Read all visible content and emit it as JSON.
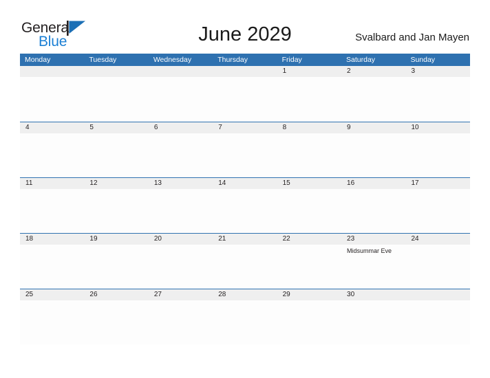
{
  "brand": {
    "name_part1": "General",
    "name_part2": "Blue",
    "flag_icon": "flag-triangle-icon",
    "accent_color": "#1b7fd4"
  },
  "header": {
    "month_title": "June 2029",
    "region": "Svalbard and Jan Mayen"
  },
  "colors": {
    "header_blue": "#2e71b0",
    "band_gray": "#efefef",
    "text_dark": "#231f20",
    "logo_blue": "#1b7fd4"
  },
  "weekdays": [
    {
      "label": "Monday"
    },
    {
      "label": "Tuesday"
    },
    {
      "label": "Wednesday"
    },
    {
      "label": "Thursday"
    },
    {
      "label": "Friday"
    },
    {
      "label": "Saturday"
    },
    {
      "label": "Sunday"
    }
  ],
  "weeks": [
    {
      "days": [
        {
          "date": "",
          "event": ""
        },
        {
          "date": "",
          "event": ""
        },
        {
          "date": "",
          "event": ""
        },
        {
          "date": "",
          "event": ""
        },
        {
          "date": "1",
          "event": ""
        },
        {
          "date": "2",
          "event": ""
        },
        {
          "date": "3",
          "event": ""
        }
      ]
    },
    {
      "days": [
        {
          "date": "4",
          "event": ""
        },
        {
          "date": "5",
          "event": ""
        },
        {
          "date": "6",
          "event": ""
        },
        {
          "date": "7",
          "event": ""
        },
        {
          "date": "8",
          "event": ""
        },
        {
          "date": "9",
          "event": ""
        },
        {
          "date": "10",
          "event": ""
        }
      ]
    },
    {
      "days": [
        {
          "date": "11",
          "event": ""
        },
        {
          "date": "12",
          "event": ""
        },
        {
          "date": "13",
          "event": ""
        },
        {
          "date": "14",
          "event": ""
        },
        {
          "date": "15",
          "event": ""
        },
        {
          "date": "16",
          "event": ""
        },
        {
          "date": "17",
          "event": ""
        }
      ]
    },
    {
      "days": [
        {
          "date": "18",
          "event": ""
        },
        {
          "date": "19",
          "event": ""
        },
        {
          "date": "20",
          "event": ""
        },
        {
          "date": "21",
          "event": ""
        },
        {
          "date": "22",
          "event": ""
        },
        {
          "date": "23",
          "event": "Midsummar Eve"
        },
        {
          "date": "24",
          "event": ""
        }
      ]
    },
    {
      "days": [
        {
          "date": "25",
          "event": ""
        },
        {
          "date": "26",
          "event": ""
        },
        {
          "date": "27",
          "event": ""
        },
        {
          "date": "28",
          "event": ""
        },
        {
          "date": "29",
          "event": ""
        },
        {
          "date": "30",
          "event": ""
        },
        {
          "date": "",
          "event": ""
        }
      ]
    }
  ]
}
